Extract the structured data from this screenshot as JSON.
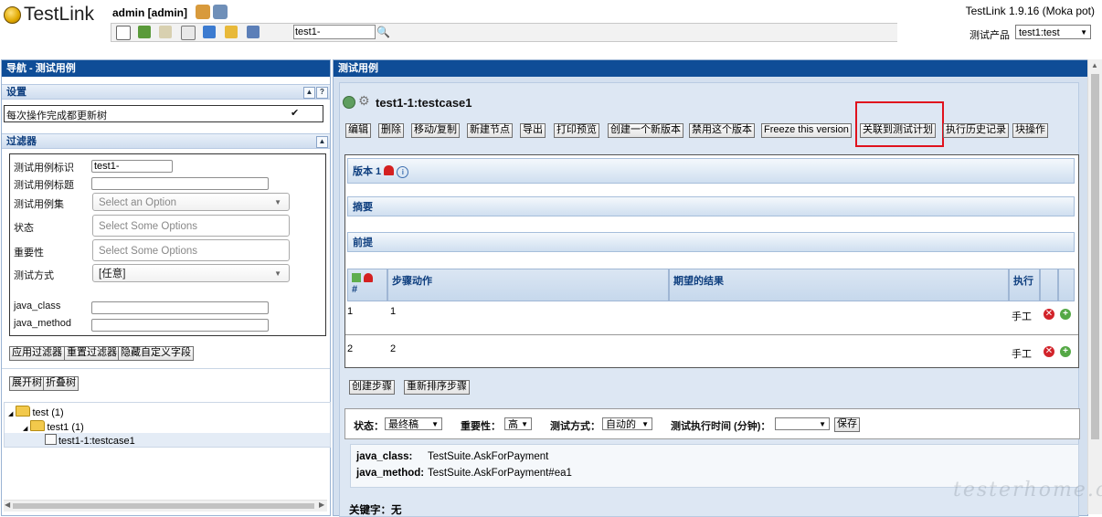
{
  "app": {
    "logo_text": "TestLink",
    "user": "admin [admin]",
    "version": "TestLink 1.9.16 (Moka pot)",
    "search_value": "test1-",
    "product_label": "测试产品",
    "product_value": "test1:test"
  },
  "left": {
    "title": "导航 - 测试用例",
    "settings": {
      "header": "设置",
      "update_tree_label": "每次操作完成都更新树",
      "update_tree_checked": "✔"
    },
    "filters": {
      "header": "过滤器",
      "tc_id_label": "测试用例标识",
      "tc_id_value": "test1-",
      "tc_title_label": "测试用例标题",
      "tc_title_value": "",
      "suite_label": "测试用例集",
      "suite_placeholder": "Select an Option",
      "status_label": "状态",
      "status_placeholder": "Select Some Options",
      "importance_label": "重要性",
      "importance_placeholder": "Select Some Options",
      "exec_type_label": "测试方式",
      "exec_type_value": "[任意]",
      "java_class_label": "java_class",
      "java_method_label": "java_method"
    },
    "buttons": {
      "apply": "应用过滤器",
      "reset": "重置过滤器",
      "hide_custom": "隐藏自定义字段",
      "expand": "展开树",
      "collapse": "折叠树"
    },
    "tree": {
      "root": "test (1)",
      "suite": "test1 (1)",
      "case": "test1-1:testcase1"
    }
  },
  "right": {
    "title": "测试用例",
    "tc_title": "test1-1:testcase1",
    "buttons": {
      "edit": "编辑",
      "delete": "删除",
      "move_copy": "移动/复制",
      "new_sibling": "新建节点",
      "export": "导出",
      "print": "打印预览",
      "new_version": "创建一个新版本",
      "disable_version": "禁用这个版本",
      "freeze": "Freeze this version",
      "add_to_plan": "关联到测试计划",
      "exec_history": "执行历史记录",
      "bulk": "块操作",
      "create_step": "创建步骤",
      "reorder_steps": "重新排序步骤",
      "save": "保存"
    },
    "version_label": "版本 1",
    "summary_label": "摘要",
    "preconditions_label": "前提",
    "steps": {
      "col_num": "#",
      "col_action": "步骤动作",
      "col_expected": "期望的结果",
      "col_exec": "执行",
      "rows": [
        {
          "num": "1",
          "action": "1",
          "exec": "手工"
        },
        {
          "num": "2",
          "action": "2",
          "exec": "手工"
        }
      ]
    },
    "status_bar": {
      "status_label": "状态：",
      "status_value": "最终稿",
      "importance_label": "重要性：",
      "importance_value": "高",
      "exec_type_label": "测试方式：",
      "exec_type_value": "自动的",
      "duration_label": "测试执行时间 (分钟)："
    },
    "java": {
      "class_label": "java_class:",
      "class_value": "TestSuite.AskForPayment",
      "method_label": "java_method:",
      "method_value": "TestSuite.AskForPayment#ea1"
    },
    "keywords": "关键字：无"
  },
  "watermark": "testerhome.com"
}
